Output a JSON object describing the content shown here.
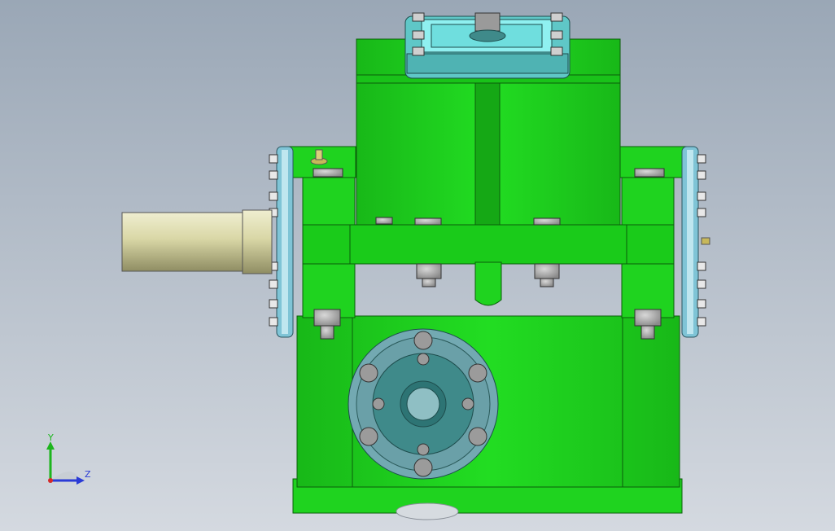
{
  "viewport": {
    "background_top": "#9aa7b6",
    "background_bottom": "#d4d9e0"
  },
  "model": {
    "housing_color": "#1fd31f",
    "housing_shadow": "#17a317",
    "cover_color": "#6fe0e0",
    "flange_color": "#5b9ea6",
    "flange_inner_color": "#3f8a8a",
    "shaft_color": "#d9d7a6",
    "bolt_color": "#a9a9a9"
  },
  "triad": {
    "y_label": "Y",
    "z_label": "Z",
    "y_color": "#1db51d",
    "z_color": "#2a3bd6",
    "x_color": "#d42a2a"
  }
}
